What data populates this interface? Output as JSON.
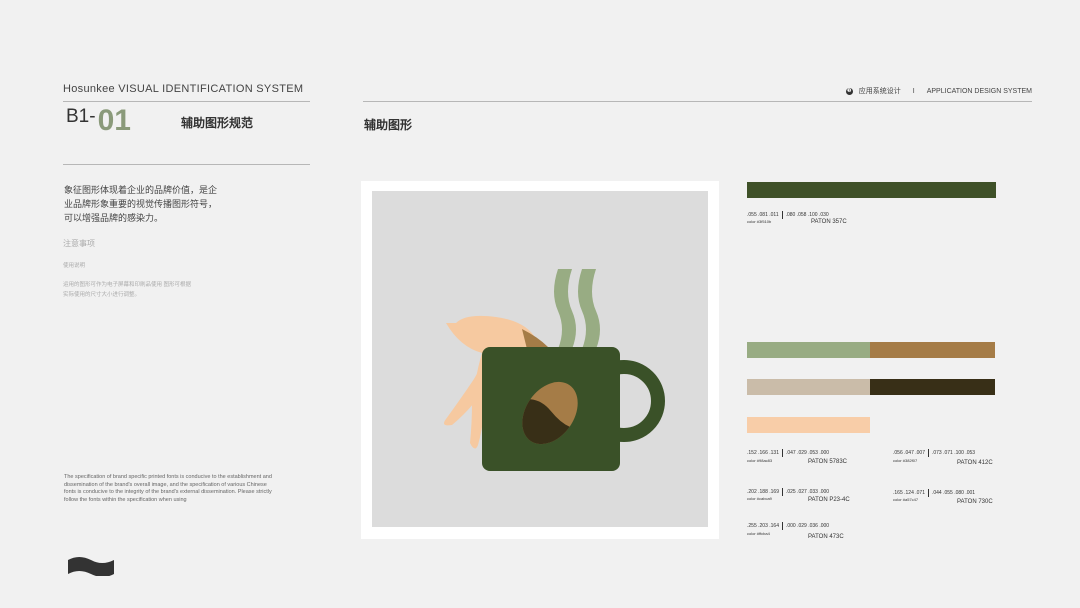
{
  "header": {
    "brand": "Hosunkee VISUAL IDENTIFICATION SYSTEM",
    "code_prefix": "B1-",
    "code_number": "01",
    "section_title": "辅助图形规范",
    "right_icon": "❸",
    "right_cn": "应用系统设计",
    "right_divider": "I",
    "right_en": "APPLICATION DESIGN SYSTEM"
  },
  "main_title": "辅助图形",
  "description": "象征图形体现着企业的品牌价值，是企业品牌形象重要的视觉传播图形符号，可以增强品牌的感染力。",
  "notes": {
    "title": "注意事项",
    "subtitle": "使用说明",
    "body": "运用的图形可作为电子屏幕和印刷品使用 图形可根据实际使用的尺寸大小进行调整。"
  },
  "english_note": "The specification of brand specific printed fonts is conducive to the establishment and dissemination of the brand's overall image, and the specification of various Chinese fonts is conducive to the integrity of the brand's external dissemination. Please strictly follow the fonts within the specification when using",
  "colors": [
    {
      "hex": "#3f510b",
      "rgb": ".055 .081 .011",
      "cmyk": ".080 .058 .100 .030",
      "code": "color #3f510b",
      "pantone": "PATON 357C"
    },
    {
      "hex": "#98ac83",
      "rgb": ".152 .166 .131",
      "cmyk": ".047 .029 .053 .000",
      "code": "color #98ac83",
      "pantone": "PATON 5783C"
    },
    {
      "hex": "#382f07",
      "rgb": ".056 .047 .007",
      "cmyk": ".073 .071 .100 .053",
      "code": "color #382f07",
      "pantone": "PATON 412C"
    },
    {
      "hex": "#cabca9",
      "rgb": ".202 .188 .169",
      "cmyk": ".025 .027 .033 .000",
      "code": "color #cabca9",
      "pantone": "PATON P23-4C"
    },
    {
      "hex": "#a57c47",
      "rgb": ".165 .124 .071",
      "cmyk": ".044 .055 .080 .001",
      "code": "color #a57c47",
      "pantone": "PATON 730C"
    },
    {
      "hex": "#ffcba4",
      "rgb": ".255 .203 .164",
      "cmyk": ".000 .029 .036 .000",
      "code": "color #ffcba4",
      "pantone": "PATON 473C"
    }
  ],
  "palette_bars": {
    "dark_green": "#3f5128",
    "sage": "#98ac83",
    "tan": "#a57c47",
    "beige": "#cabca9",
    "dark_brown": "#382f17",
    "peach": "#f8cda8"
  },
  "illustration": {
    "icon": "coffee-mug-with-legs-icon",
    "mug_color": "#3a5128",
    "steam_color": "#98ac83",
    "bean_color": "#a57c47",
    "leg_color": "#f6c9a0",
    "background": "#dcdcdc"
  }
}
